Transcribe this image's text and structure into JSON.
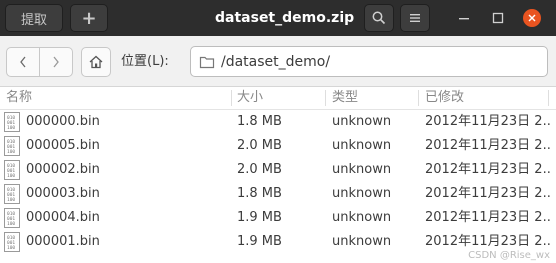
{
  "header": {
    "extract_label": "提取",
    "add_label": "+",
    "title": "dataset_demo.zip"
  },
  "toolbar": {
    "location_label": "位置(L):",
    "path": "/dataset_demo/"
  },
  "columns": {
    "name": "名称",
    "size": "大小",
    "type": "类型",
    "modified": "已修改"
  },
  "files": [
    {
      "name": "000000.bin",
      "size": "1.8 MB",
      "type": "unknown",
      "modified": "2012年11月23日 2..."
    },
    {
      "name": "000005.bin",
      "size": "2.0 MB",
      "type": "unknown",
      "modified": "2012年11月23日 2..."
    },
    {
      "name": "000002.bin",
      "size": "2.0 MB",
      "type": "unknown",
      "modified": "2012年11月23日 2..."
    },
    {
      "name": "000003.bin",
      "size": "1.8 MB",
      "type": "unknown",
      "modified": "2012年11月23日 2..."
    },
    {
      "name": "000004.bin",
      "size": "1.9 MB",
      "type": "unknown",
      "modified": "2012年11月23日 2..."
    },
    {
      "name": "000001.bin",
      "size": "1.9 MB",
      "type": "unknown",
      "modified": "2012年11月23日 2..."
    }
  ],
  "watermark": "CSDN @Rise_wx",
  "colors": {
    "headerbar": "#2d2d2d",
    "close_button": "#e95420",
    "background": "#ffffff"
  }
}
